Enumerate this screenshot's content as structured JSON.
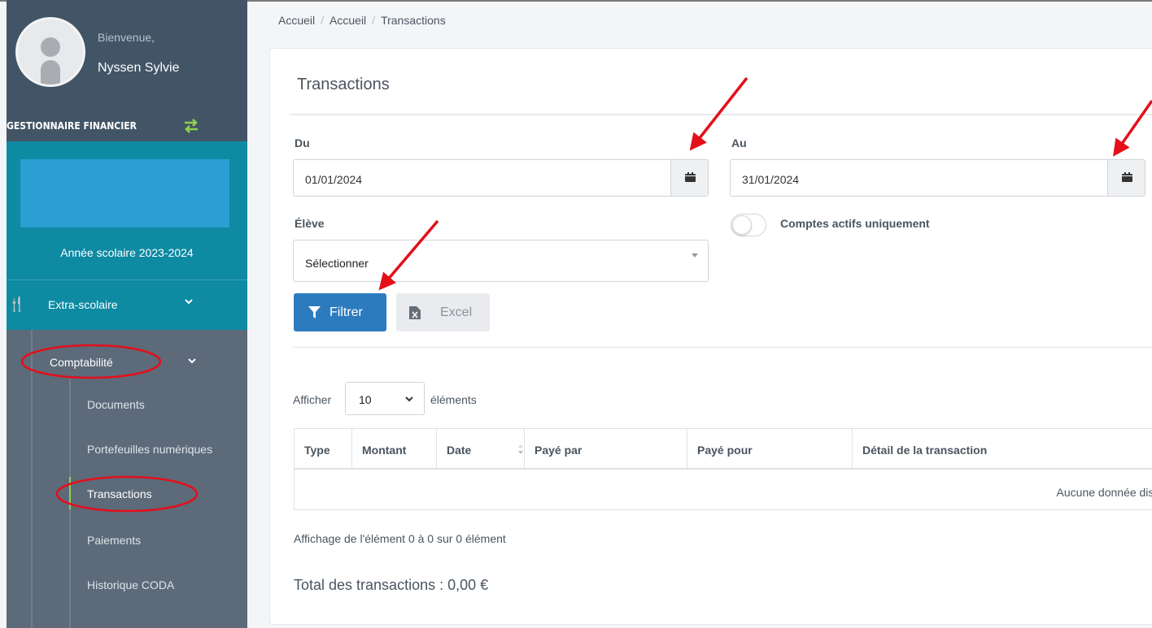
{
  "user": {
    "welcome": "Bienvenue,",
    "name": "Nyssen Sylvie"
  },
  "sidebar": {
    "role": "GESTIONNAIRE FINANCIER",
    "school_year": "Année scolaire 2023-2024",
    "menu": {
      "extra_label": "Extra-scolaire",
      "compta_label": "Comptabilité",
      "sub_items": [
        {
          "label": "Documents"
        },
        {
          "label": "Portefeuilles numériques"
        },
        {
          "label": "Transactions"
        },
        {
          "label": "Paiements"
        },
        {
          "label": "Historique CODA"
        }
      ]
    }
  },
  "breadcrumb": [
    "Accueil",
    "Accueil",
    "Transactions"
  ],
  "page": {
    "title": "Transactions",
    "filters": {
      "from_label": "Du",
      "from_value": "01/01/2024",
      "to_label": "Au",
      "to_value": "31/01/2024",
      "student_label": "Élève",
      "student_value": "Sélectionner",
      "active_only_label": "Comptes actifs uniquement",
      "active_only_checked": false
    },
    "buttons": {
      "filter": "Filtrer",
      "excel": "Excel"
    },
    "table": {
      "show_label": "Afficher",
      "page_length": "10",
      "elements_label": "éléments",
      "columns": [
        "Type",
        "Montant",
        "Date",
        "Payé par",
        "Payé pour",
        "Détail de la transaction"
      ],
      "empty_text": "Aucune donnée dispo"
    },
    "info": "Affichage de l'élément 0 à 0 sur 0 élément",
    "total": "Total des transactions : 0,00 €"
  },
  "colors": {
    "sidebar_bg": "#5d6a79",
    "sidebar_dark": "#425566",
    "accent_teal": "#0e8aa3",
    "primary_button": "#2d7bbf",
    "active_indicator": "#8fd14f",
    "annotation_red": "#e3101a"
  },
  "icons": [
    "user-icon",
    "switch-icon",
    "cutlery-icon",
    "chevron-down-icon",
    "calendar-icon",
    "filter-icon",
    "excel-file-icon",
    "sort-icon"
  ]
}
